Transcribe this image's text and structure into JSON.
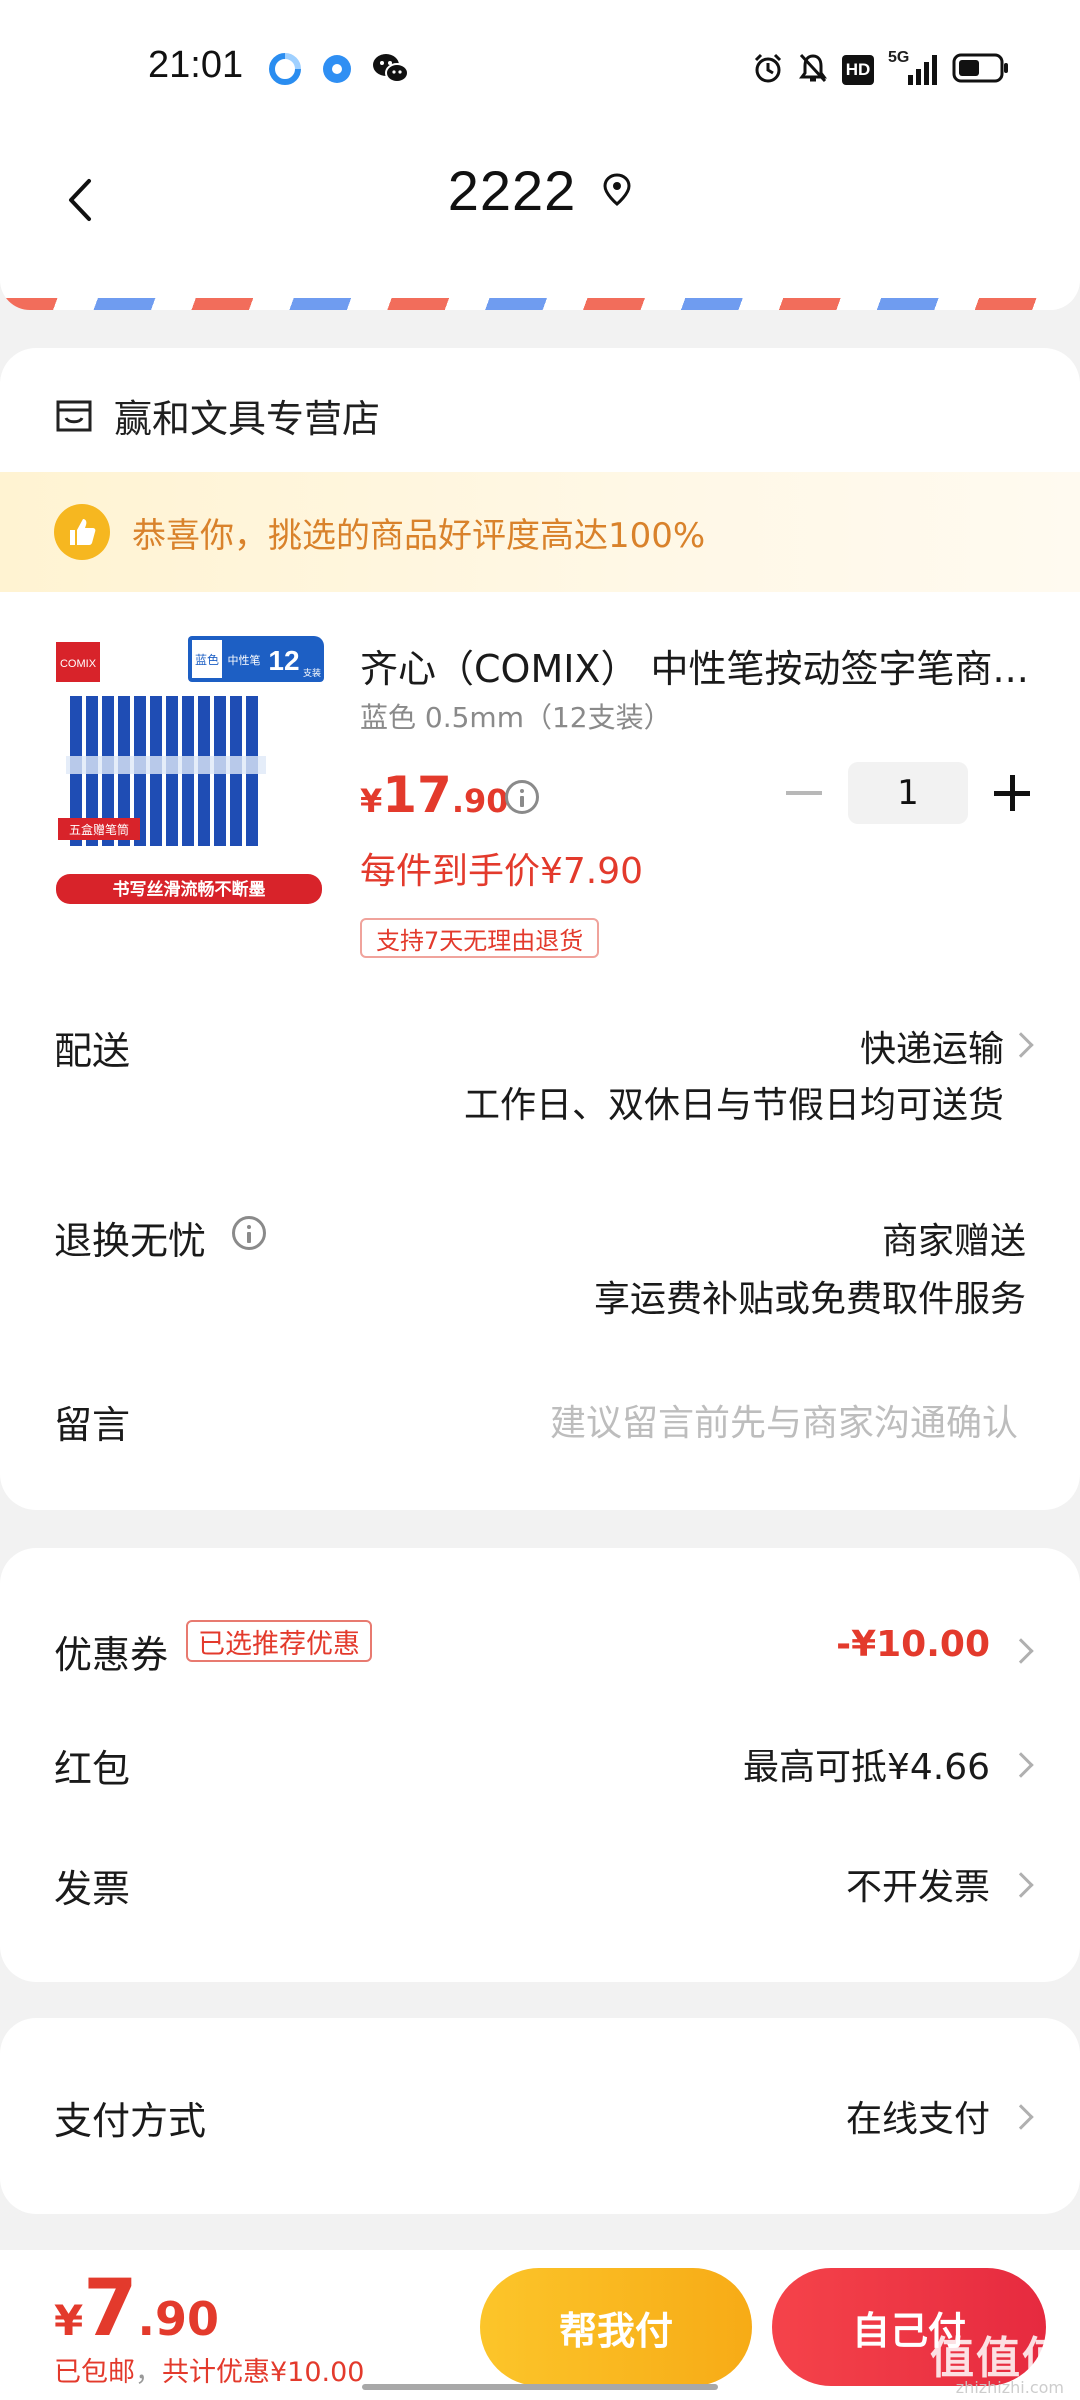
{
  "status_bar": {
    "time": "21:01",
    "network": "5G",
    "hd": "HD"
  },
  "header": {
    "title": "2222"
  },
  "shop": {
    "name": "赢和文具专营店",
    "praise": "恭喜你，挑选的商品好评度高达100%"
  },
  "product": {
    "title": "齐心（COMIX） 中性笔按动签字笔商...",
    "spec": "蓝色 0.5mm（12支装）",
    "price_currency": "¥",
    "price_int": "17",
    "price_dec": ".90",
    "quantity": "1",
    "final_price": "每件到手价¥7.90",
    "return_tag": "支持7天无理由退货",
    "image_text": {
      "brand": "COMIX",
      "color": "蓝色",
      "type": "中性笔",
      "count": "12",
      "unit": "支装",
      "gift": "五盒赠笔筒",
      "slogan": "书写丝滑流畅不断墨"
    }
  },
  "delivery": {
    "label": "配送",
    "value": "快递运输",
    "sub": "工作日、双休日与节假日均可送货"
  },
  "returns": {
    "label": "退换无忧",
    "value": "商家赠送",
    "sub": "享运费补贴或免费取件服务"
  },
  "message": {
    "label": "留言",
    "placeholder": "建议留言前先与商家沟通确认"
  },
  "coupon": {
    "label": "优惠券",
    "tag": "已选推荐优惠",
    "value": "-¥10.00"
  },
  "red_packet": {
    "label": "红包",
    "value": "最高可抵¥4.66"
  },
  "invoice": {
    "label": "发票",
    "value": "不开发票"
  },
  "payment": {
    "label": "支付方式",
    "value": "在线支付"
  },
  "bottom": {
    "currency": "¥",
    "total_int": "7",
    "total_dec": ".90",
    "shipping_note": "已包邮",
    "discount_note": "共计优惠¥10.00",
    "help_pay": "帮我付",
    "self_pay": "自己付",
    "watermark": "值值值",
    "watermark_site": "zhizhizhi.com"
  },
  "colors": {
    "accent_red": "#e33a2c",
    "yellow_button": "#f7ab16",
    "red_button": "#e62a3f",
    "praise_text": "#d9822b"
  }
}
